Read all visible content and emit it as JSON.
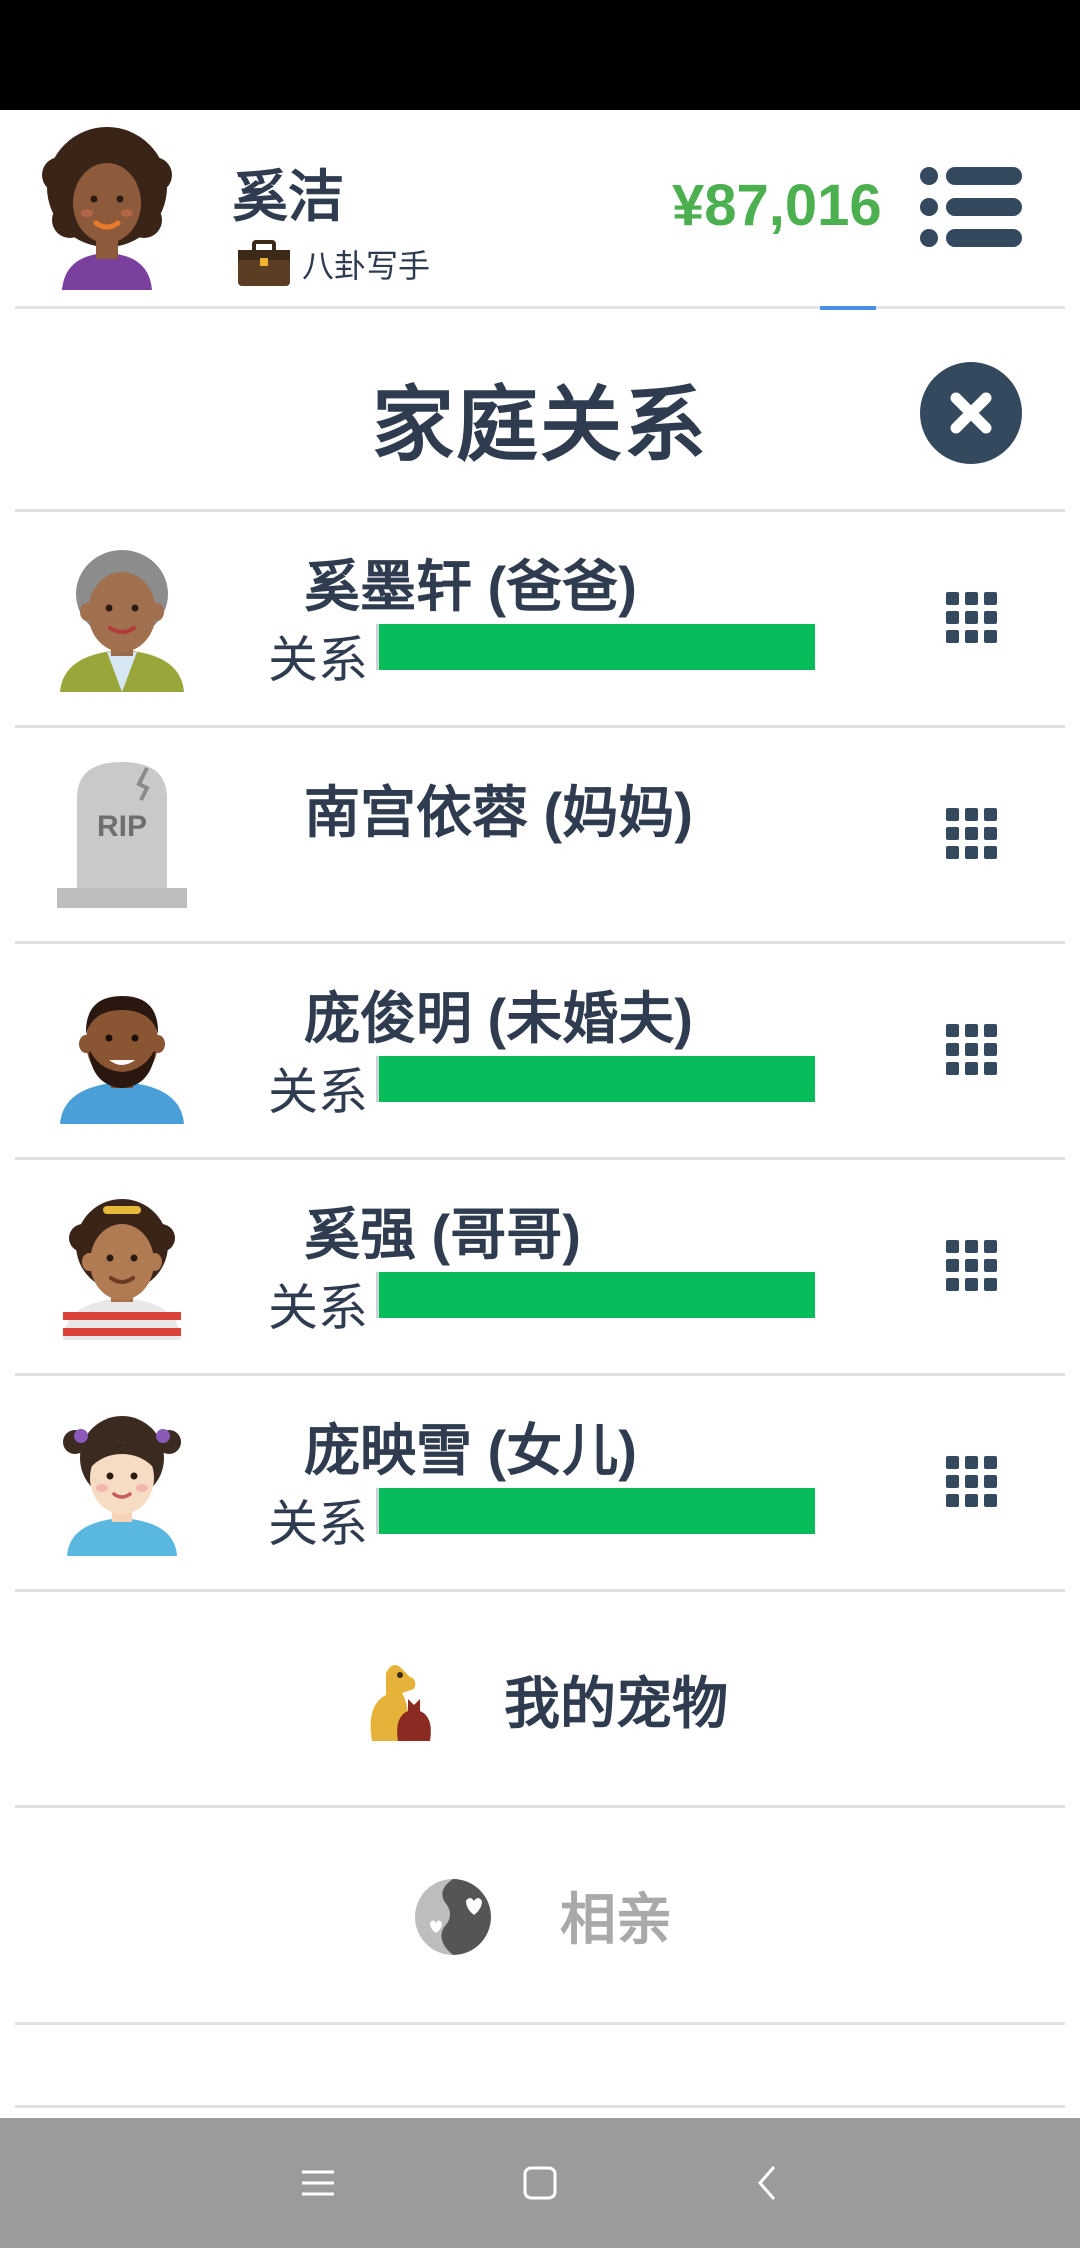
{
  "header": {
    "username": "奚洁",
    "job": "八卦写手",
    "money": "¥87,016"
  },
  "page": {
    "title": "家庭关系"
  },
  "members": [
    {
      "name": "奚墨轩 (爸爸)",
      "relation_label": "关系",
      "relation_level": 1.0,
      "alive": true
    },
    {
      "name": "南宫依蓉 (妈妈)",
      "relation_label": "",
      "relation_level": null,
      "alive": false,
      "tomb_text": "RIP"
    },
    {
      "name": "庞俊明 (未婚夫)",
      "relation_label": "关系",
      "relation_level": 1.0,
      "alive": true
    },
    {
      "name": "奚强 (哥哥)",
      "relation_label": "关系",
      "relation_level": 1.0,
      "alive": true
    },
    {
      "name": "庞映雪 (女儿)",
      "relation_label": "关系",
      "relation_level": 1.0,
      "alive": true
    }
  ],
  "actions": {
    "pets": "我的宠物",
    "dating": "相亲"
  },
  "colors": {
    "accent_green": "#4caf50",
    "relation_bar": "#08bc5b",
    "text_dark": "#2f3c4f",
    "close_button": "#34495e",
    "nav_bar": "#9b9b9b"
  },
  "icons": [
    "briefcase-icon",
    "menu-list-icon",
    "close-icon",
    "grid-menu-icon",
    "pet-dog-cat-icon",
    "dating-hearts-icon",
    "nav-menu-icon",
    "nav-home-icon",
    "nav-back-icon"
  ]
}
